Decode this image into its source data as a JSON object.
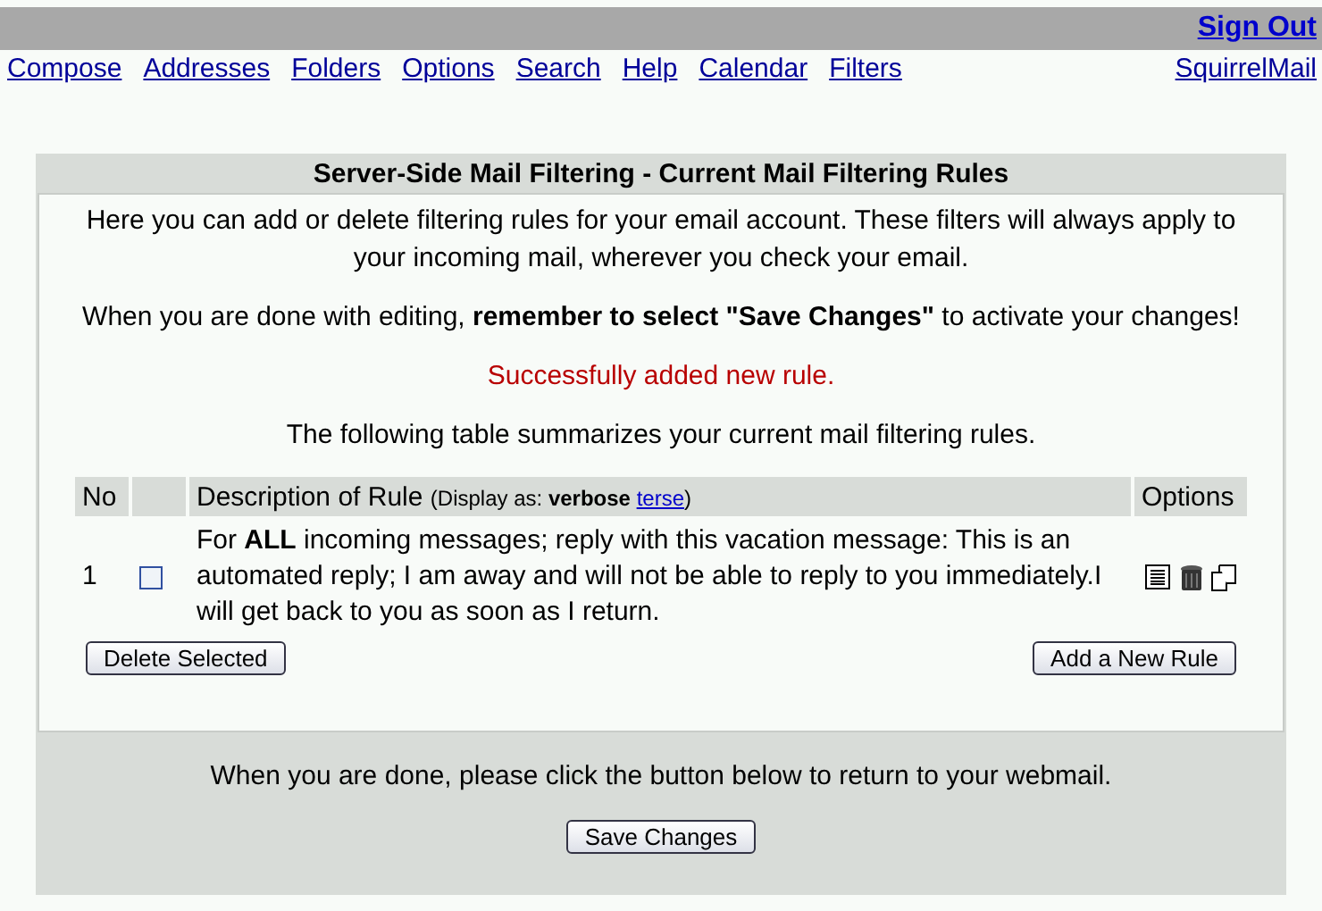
{
  "top_bar": {
    "sign_out": "Sign Out"
  },
  "nav": {
    "links": [
      "Compose",
      "Addresses",
      "Folders",
      "Options",
      "Search",
      "Help",
      "Calendar",
      "Filters"
    ],
    "brand_link": "SquirrelMail"
  },
  "panel": {
    "title": "Server-Side Mail Filtering - Current Mail Filtering Rules",
    "intro": "Here you can add or delete filtering rules for your email account. These filters will always apply to your incoming mail, wherever you check your email.",
    "reminder": "When you are done with editing, **remember to select \"Save Changes\"** to activate your changes!",
    "status_message": "Successfully added new rule.",
    "summary": "The following table summarizes your current mail filtering rules.",
    "table": {
      "columns": [
        {
          "kind": "no",
          "label": "No"
        },
        {
          "kind": "check"
        },
        {
          "kind": "desc",
          "label": "Description of Rule",
          "note_prefix": "(Display as: **verbose** ",
          "note_link": "terse",
          "note_suffix": ")"
        },
        {
          "kind": "options",
          "label": "Options"
        }
      ],
      "rows": [
        {
          "no": "1",
          "checked": false,
          "description": "For **ALL** incoming messages; reply with this vacation message: This is an automated reply; I am away and will not be able to reply to you immediately.I will get back to you as soon as I return."
        }
      ]
    },
    "delete_button": "Delete Selected",
    "add_button": "Add a New Rule",
    "footer_text": "When you are done, please click the button below to return to your webmail.",
    "save_button": "Save Changes"
  }
}
